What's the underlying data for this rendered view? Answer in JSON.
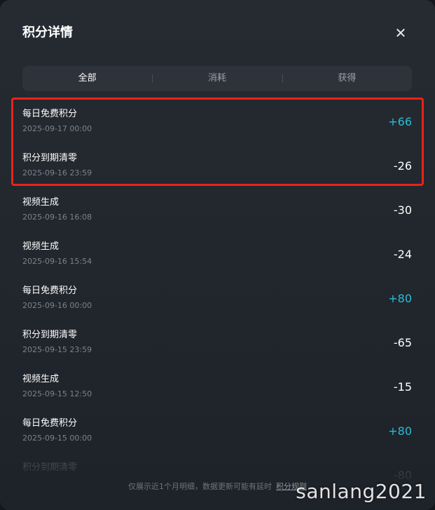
{
  "modal": {
    "title": "积分详情",
    "close_icon": "close-icon",
    "close_glyph": "✕"
  },
  "tabs": [
    {
      "label": "全部",
      "active": true
    },
    {
      "label": "消耗",
      "active": false
    },
    {
      "label": "获得",
      "active": false
    }
  ],
  "records": [
    {
      "name": "每日免费积分",
      "time": "2025-09-17 00:00",
      "amount": "+66"
    },
    {
      "name": "积分到期清零",
      "time": "2025-09-16 23:59",
      "amount": "-26"
    },
    {
      "name": "视频生成",
      "time": "2025-09-16 16:08",
      "amount": "-30"
    },
    {
      "name": "视频生成",
      "time": "2025-09-16 15:54",
      "amount": "-24"
    },
    {
      "name": "每日免费积分",
      "time": "2025-09-16 00:00",
      "amount": "+80"
    },
    {
      "name": "积分到期清零",
      "time": "2025-09-15 23:59",
      "amount": "-65"
    },
    {
      "name": "视频生成",
      "time": "2025-09-15 12:50",
      "amount": "-15"
    },
    {
      "name": "每日免费积分",
      "time": "2025-09-15 00:00",
      "amount": "+80"
    },
    {
      "name": "积分到期清零",
      "time": "",
      "amount": "-80"
    }
  ],
  "footer": {
    "note": "仅展示近1个月明细，数据更新可能有延时",
    "rules_link": "积分规则"
  },
  "watermark": "sanlang2021",
  "colors": {
    "background": "#1e2229",
    "positive_amount": "#2bbcd6",
    "highlight_border": "#e8231a"
  }
}
